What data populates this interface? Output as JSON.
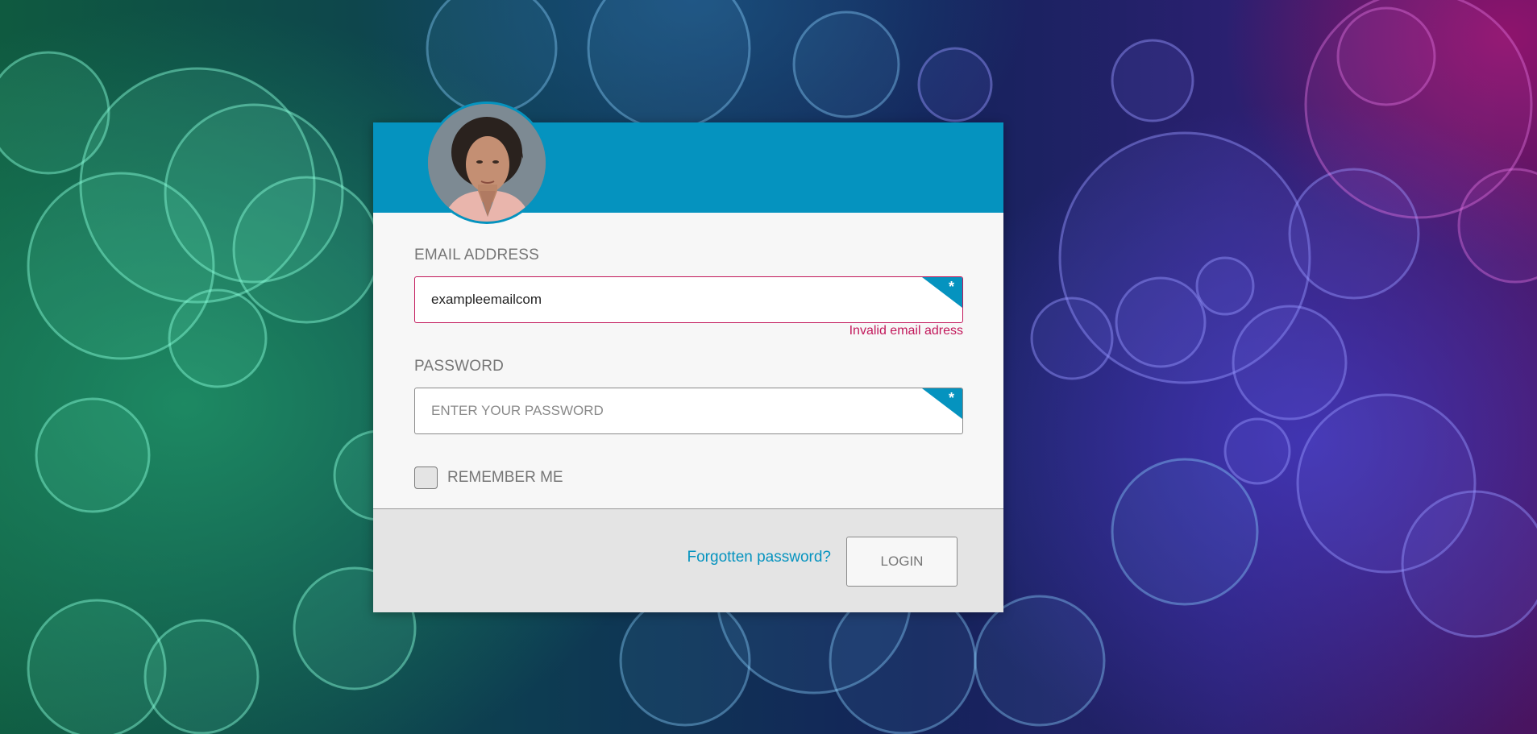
{
  "login_form": {
    "email": {
      "label": "EMAIL ADDRESS",
      "value": "exampleemailcom",
      "required_marker": "*",
      "error": "Invalid email adress"
    },
    "password": {
      "label": "PASSWORD",
      "placeholder": "ENTER YOUR PASSWORD",
      "required_marker": "*"
    },
    "remember_me": {
      "label": "REMEMBER ME",
      "checked": false
    },
    "forgot_password": "Forgotten password?",
    "login_button": "LOGIN"
  },
  "colors": {
    "accent": "#0593bf",
    "error": "#c2185b",
    "label": "#767676",
    "footer": "#e4e4e4"
  },
  "icons": {
    "avatar": "user-avatar-photo",
    "required": "asterisk-corner-icon"
  }
}
